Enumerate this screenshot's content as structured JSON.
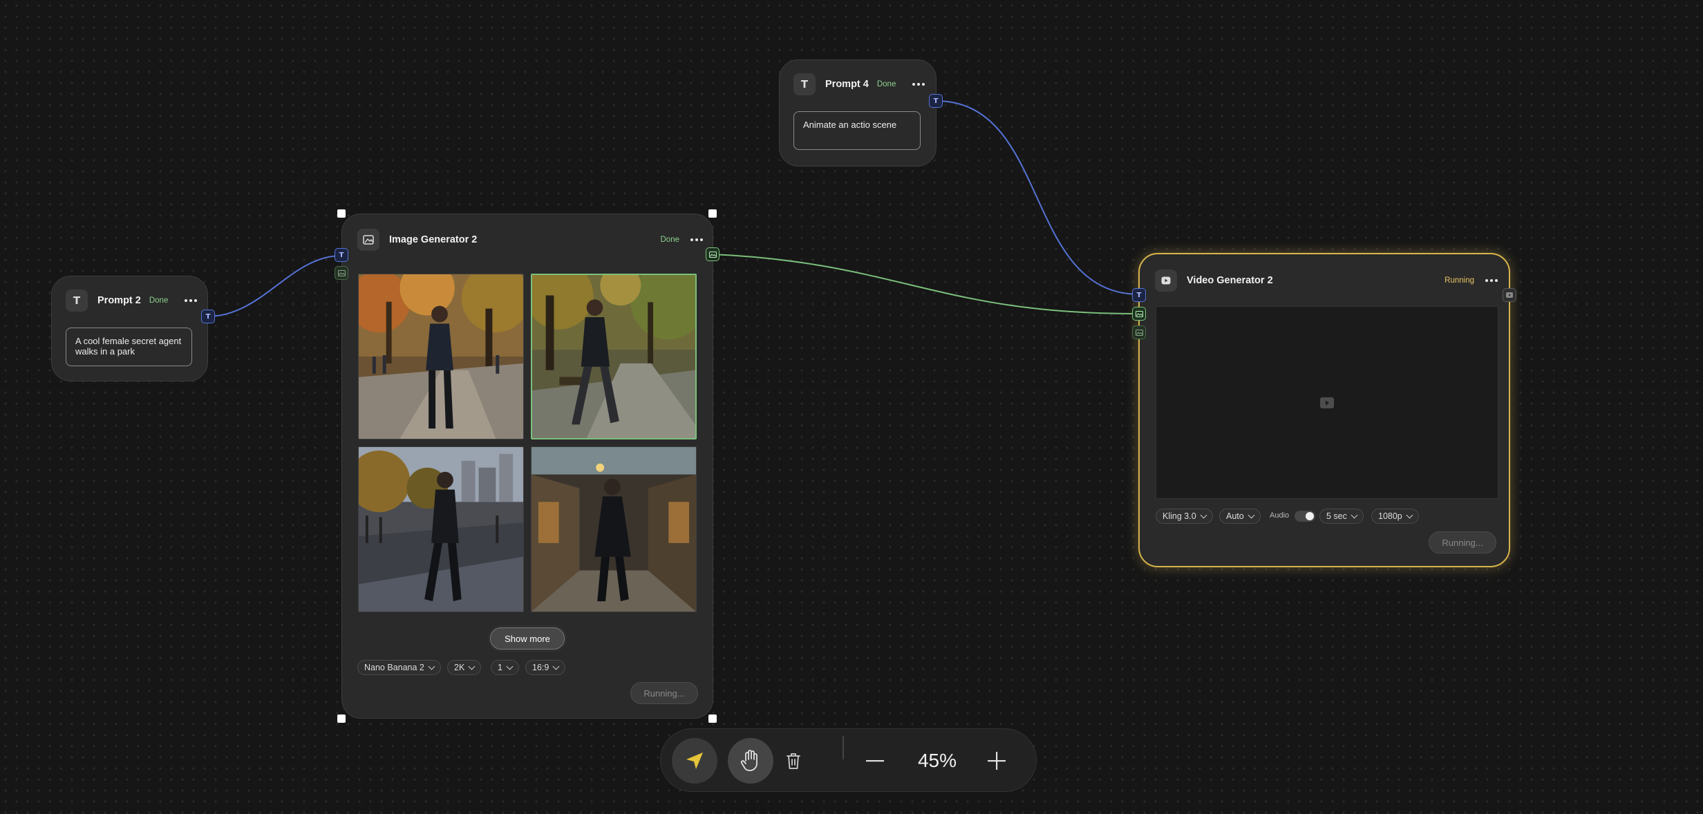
{
  "colors": {
    "text_port": "#5573d6",
    "image_port": "#7bc07b",
    "running": "#e7c463",
    "done": "#8fd18f",
    "send_arrow": "#e6c53a"
  },
  "nodes": {
    "prompt2": {
      "icon": "T",
      "title": "Prompt 2",
      "status": "Done",
      "text": "A cool female secret agent walks in a park",
      "port_label": "T"
    },
    "prompt4": {
      "icon": "T",
      "title": "Prompt 4",
      "status": "Done",
      "text": "Animate an actio scene",
      "port_label": "T"
    },
    "image_generator": {
      "icon": "image-icon",
      "title": "Image Generator 2",
      "status": "Done",
      "input_port_labels": [
        "T",
        "image-icon"
      ],
      "images": [
        {
          "name": "agent-in-autumn-park",
          "selected": false
        },
        {
          "name": "agent-walking-park-path",
          "selected": true
        },
        {
          "name": "agent-wet-city-park",
          "selected": false
        },
        {
          "name": "agent-cobblestone-arcade",
          "selected": false
        }
      ],
      "show_more_label": "Show more",
      "settings": [
        "Nano Banana 2",
        "2K",
        "1",
        "16:9"
      ],
      "run_label": "Running..."
    },
    "video_generator": {
      "icon": "video-icon",
      "title": "Video Generator 2",
      "status": "Running",
      "model": "Kling 3.0",
      "mode": "Auto",
      "audio_label": "Audio",
      "audio_enabled": true,
      "duration": "5 sec",
      "resolution": "1080p",
      "run_label": "Running..."
    }
  },
  "toolbar": {
    "tools": [
      "send-arrow-icon",
      "hand-icon",
      "trash-icon"
    ],
    "zoom_out_icon": "minus-icon",
    "zoom_level": "45%",
    "zoom_in_icon": "plus-icon"
  }
}
